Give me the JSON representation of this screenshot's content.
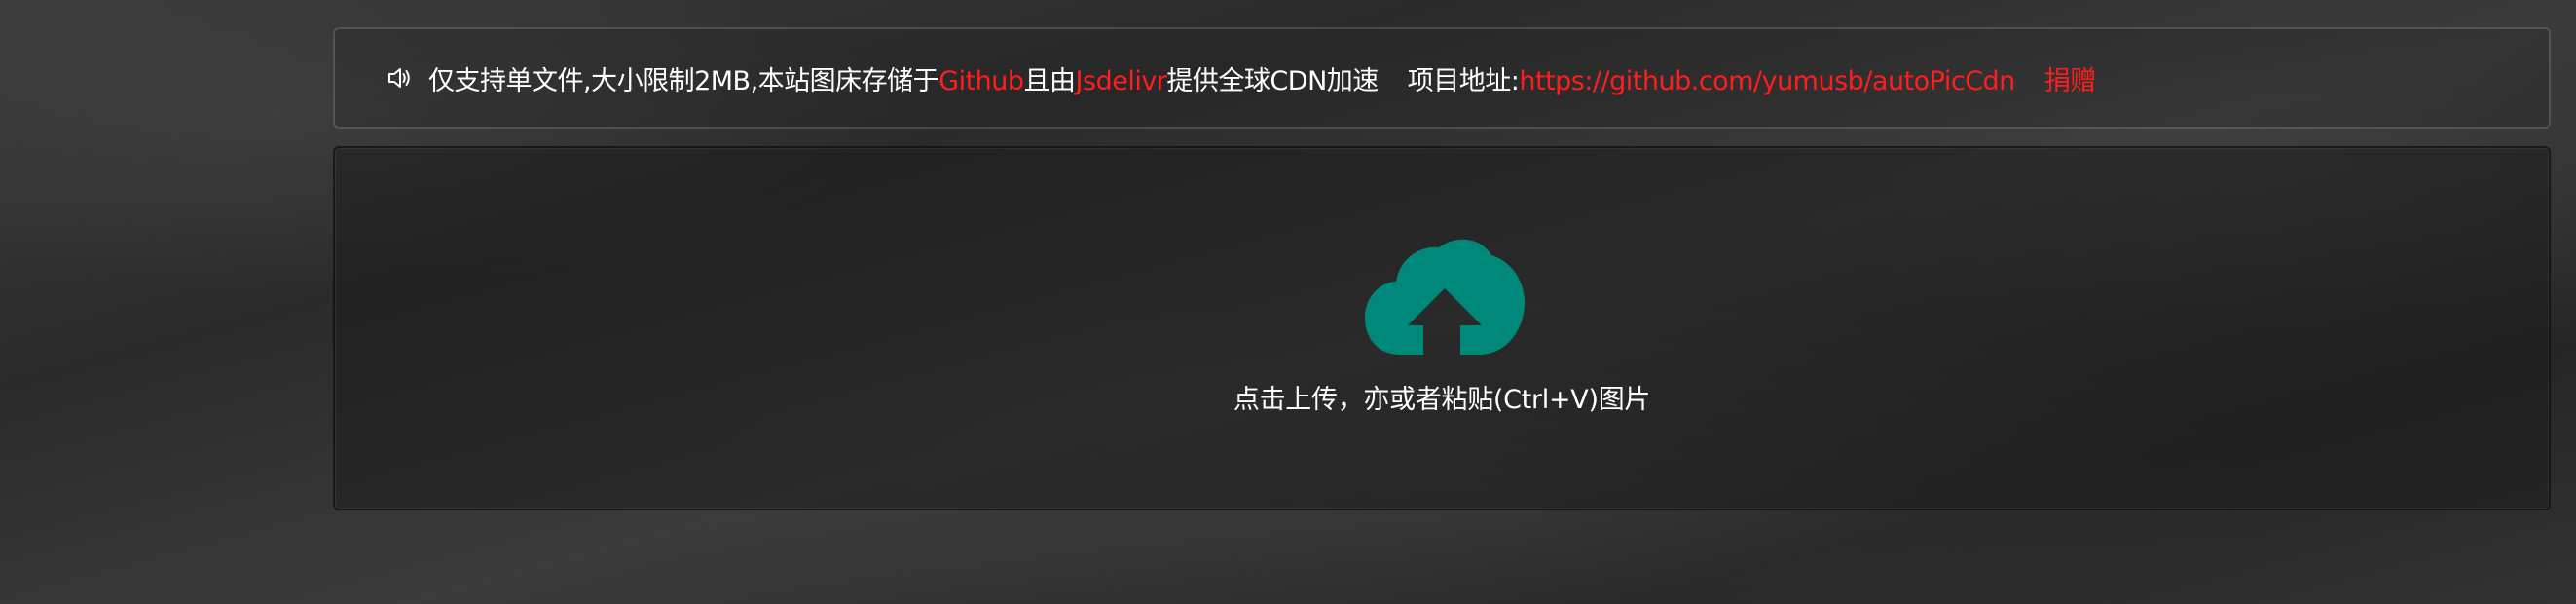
{
  "notice": {
    "icon": "speaker-icon",
    "text_1": "仅支持单文件,大小限制2MB,本站图床存储于",
    "github_label": "Github",
    "text_2": "且由",
    "jsdelivr_label": "Jsdelivr",
    "text_3": "提供全球CDN加速",
    "project_label": "项目地址:",
    "project_url": "https://github.com/yumusb/autoPicCdn",
    "donate_label": "捐赠",
    "accent_color": "#ff1e1e"
  },
  "upload": {
    "icon": "cloud-upload-icon",
    "icon_color": "#00897b",
    "hint": "点击上传，亦或者粘贴(Ctrl+V)图片"
  }
}
